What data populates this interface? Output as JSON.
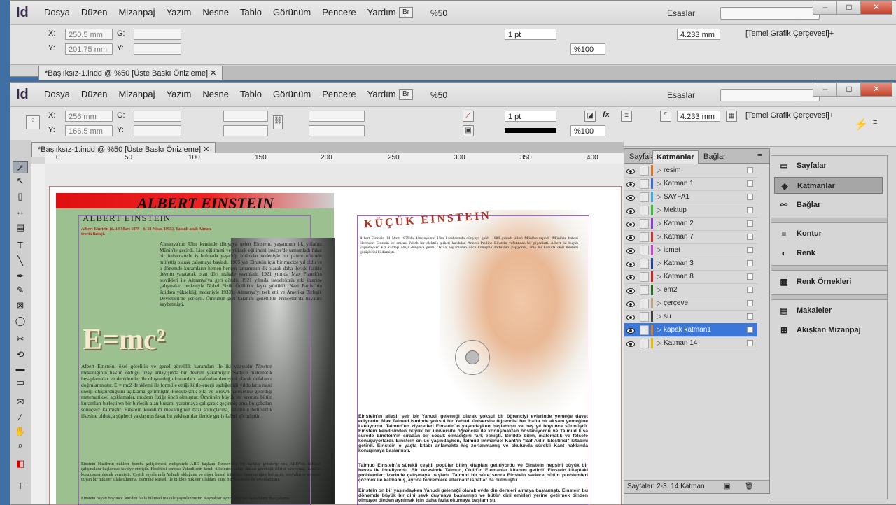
{
  "app": {
    "logo": "Id",
    "essentials": "Esaslar",
    "zoom": "%50",
    "bridge": "Br"
  },
  "menu": [
    "Dosya",
    "Düzen",
    "Mizanpaj",
    "Yazım",
    "Nesne",
    "Tablo",
    "Görünüm",
    "Pencere",
    "Yardım"
  ],
  "back_window": {
    "x": "250.5 mm",
    "y": "201.75 mm",
    "stroke": "1 pt",
    "size": "4.233 mm",
    "percent": "%100",
    "frame_style": "[Temel Grafik Çerçevesi]+",
    "tab": "*Başlıksız-1.indd @ %50 [Üste Baskı Önizleme]"
  },
  "front_window": {
    "x": "256 mm",
    "y": "166.5 mm",
    "stroke": "1 pt",
    "size": "4.233 mm",
    "percent": "%100",
    "frame_style": "[Temel Grafik Çerçevesi]+",
    "tab": "*Başlıksız-1.indd @ %50 [Üste Baskı Önizleme]"
  },
  "labels": {
    "x": "X:",
    "y": "Y:",
    "w": "G:",
    "h": "Y:"
  },
  "ruler": [
    "0",
    "50",
    "100",
    "150",
    "200",
    "250",
    "300",
    "350",
    "400"
  ],
  "document": {
    "left_title": "ALBERT EINSTEIN",
    "left_subtitle": "ALBERT EINSTEIN",
    "left_dates": "Albert Einstein (d. 14 Mart 1879 - ö. 18 Nisan 1955), Yahudi asıllı Alman teorik fizikçi.",
    "left_body1": "Almanya'nın Ulm kentinde dünyaya gelen Einstein, yaşamının ilk yıllarını Münih'te geçirdi. Lise eğitimini ve yüksek eğitimini İsviçre'de tamamladı fakat bir üniversitede iş bulmada yaşadığı zorluklar nedeniyle bir patent ofisinde müfettiş olarak çalışmaya başladı. 1905 yılı Einstein için bir mucize yıl oldu ve o dönemde kuramların hemen hemen tamamının ilk olarak daha ileride fizikte devrim yaratacak olan dört makale yayınladı. 1921 yılında Max Planck'ın teşvikleri ile Almanya'ya geri döndü. 1921 yılında fotoelektrik etki üzerine çalışmaları nedeniyle Nobel Fizik Ödülü'ne layık görüldü. Nazi Partisi'nin iktidara yükseldiği nedeniyle 1933'te Almanya'yı terk etti ve Amerika Birleşik Devletleri'ne yerleşti. Ömrünün geri kalanını genellikle Princeton'da bayatını kaybetmişti.",
    "equation": "E=mc²",
    "left_body2": "Albert Einstein, özel görelilik ve genel görelilik kuramları ile iki yüzyıldır Newton mekaniğinin hakim olduğu uzay anlayışında bir devrim yaratmıştır. Sadece matematik hesaplamalar ve denklemler ile oluşturduğu kuramları tarafından deneysel olarak defalarca doğrulanmıştır. E = mc2 denklemi ile formüle ettiği kütle-enerji eşdeğerliği yıldızların nasıl enerji oluşturduğunu açıklama getirmiştir. Fotoelektrik etki ve Brown hareketine getirdiği matematiksel açıklamalar, modern fiziğe öncü olmuştur. Ömrünün büyük bir kısmını bütün kuramları birleştiren bir birleşik alan kuramı yaratmaya çalışarak geçirmiş ama bu çabaları sonuçsuz kalmıştır. Einstein kuantum mekaniğinin bazı sonuçlarına, özellikle belirsizlik ilkesine oldukça şüpheci yaklaşmış fakat bu yaklaşımlar ileride genis kabul görmüştür.",
    "left_body3": "Einstein Nazilerin nükleer bomba geliştirmesi endişesiyle ABD başkanı Roosevelt'e bir mektup gönderip onu ABD'nin nükleer çalışmalara başlaması tavsiye etmiştir. Hooktosi sonrası Yahudilerin kendi ülkelerine sahip olması gerektiği fikrini savunmuş, İsrail'in kuruluşuna destek vermiştir. Çeşitli eşyalarında Yahudi olduğunu ve diğer kutsal kitaplara inanmadığını belirtmiş, sosyalizme sempati duyan bir nükleer silahsızlanma. Bertrand Russell ile birlikte nükleer silahlara karşı bir manifesto da yayınlamıştır.",
    "left_body4": "Einstein hayatı boyunca 300'den fazla bilimsel makale yayınlanmıştır. Kaynaklar ayrıca 150'den fazla bilim dışı çalışma",
    "right_title": "KÜÇÜK EINSTEIN",
    "right_body1": "Albert Einstein 14 Mart 1879'da Almanya'nın Ulm kasabasında dünyaya geldi. 1880 yılında ailesi Münih'e taşındı. Münih'te babası Hermann Einstein ve amcası Jakob bir elektrik şirketi kurdular. Annesi Pauline Einstein vefatından bir piyanistti. Albert iki buçuk yaşındayken kız kardeşi Maja dünyaya geldi. Okula başlamadan önce konuşma zorlukları yaşıyordu, ama bu konuda okul müdürü görüşlerini bildirmişti.",
    "right_body2": "Einstein'ın ailesi, şeir bir Yahudi geleneği olarak yoksul bir öğrenciyi evlerinde yemeğe davet ediyordu. Max Talmud isminde yoksul bir Yahudi üniversite öğrencisi her hafta bir akşam yemeğine katılıyordu. Talmud'un ziyaretleri Einstein'ın yaşındayken başlamıştı ve beş yıl boyunca sürmüştü. Einstein kendisinden büyük bir üniversite öğrencisi ile konuşmaktan hoşlanıyordu ve Talmud kısa sürede Einstein'ın sıradan bir çocuk olmadığını fark etmişti. Birlikte bilim, matematik ve felsefe konuşuyorlardı. Einstein on üç yaşındayken, Talmud Immanuel Kant'ın \"Saf Aklın Eleştirisi\" kitabını getirdi. Einstein o yaşta kitabı anlamakta hiç zorlanmamış ve okulunda sürekli Kant hakkında konuşmaya başlamıştı.",
    "right_body3": "Talmud Einstein'a sürekli çeşitli popüler bilim kitapları getiriyordu ve Einstein hepsini büyük bir heves ile inceliyordu. Bir keresinde Talmud, Öklid'in Elemanlar kitabını getirdi. Einstein kitaptaki problemler üzerinde çalışmaya başladı. Talmud bir süre sonra Einstein sadece bütün problemleri çözmek ile kalmamış, ayrıca teoremlere alternatif ispatlar da bulmuştu.",
    "right_body4": "Einstein on bir yaşındayken Yahudi geleneği olarak evde din dersleri almaya başlamıştı. Einstein bu dönemde büyük bir dini şevk duymaya başlamıştı ve bütün dini emirleri yerine getirmek dinden olmuyor dinden ayrılmak için daha fazla okumaya başlamıştı."
  },
  "layers_panel": {
    "tabs": [
      "Sayfalar",
      "Katmanlar",
      "Bağlar"
    ],
    "active_tab": "Katmanlar",
    "layers": [
      {
        "name": "resim",
        "color": "#e07020"
      },
      {
        "name": "Katman 1",
        "color": "#3a6bd8"
      },
      {
        "name": "SAYFA1",
        "color": "#2fb0e0"
      },
      {
        "name": "Mektup",
        "color": "#30c030"
      },
      {
        "name": "Katman 2",
        "color": "#8a3ad8"
      },
      {
        "name": "Katman 7",
        "color": "#d03030"
      },
      {
        "name": "ismet",
        "color": "#d040d0"
      },
      {
        "name": "Katman 3",
        "color": "#2040a0"
      },
      {
        "name": "Katman 8",
        "color": "#d02020"
      },
      {
        "name": "em2",
        "color": "#207020"
      },
      {
        "name": "çerçeve",
        "color": "#c0a080"
      },
      {
        "name": "su",
        "color": "#404040"
      },
      {
        "name": "kapak katman1",
        "color": "#e08020",
        "selected": true
      },
      {
        "name": "Katman 14",
        "color": "#e0c000"
      }
    ],
    "footer": "Sayfalar: 2-3, 14 Katman"
  },
  "dock": {
    "group1": [
      "Sayfalar",
      "Katmanlar",
      "Bağlar"
    ],
    "active": "Katmanlar",
    "group2": [
      "Kontur",
      "Renk"
    ],
    "group3": [
      "Renk Örnekleri"
    ],
    "group4": [
      "Makaleler",
      "Akışkan Mizanpaj"
    ]
  },
  "colors": {
    "accent": "#3a77d8",
    "left_page": "#9cc08f",
    "title_red": "#d11111",
    "frame": "#a060d0"
  }
}
